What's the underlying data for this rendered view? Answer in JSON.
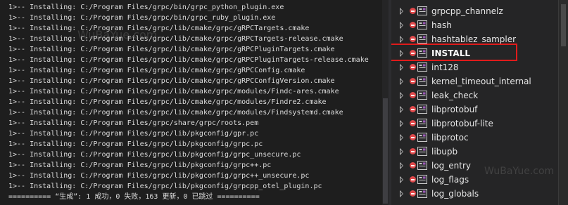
{
  "output": {
    "lines": [
      "1>-- Installing: C:/Program Files/grpc/bin/grpc_python_plugin.exe",
      "1>-- Installing: C:/Program Files/grpc/bin/grpc_ruby_plugin.exe",
      "1>-- Installing: C:/Program Files/grpc/lib/cmake/grpc/gRPCTargets.cmake",
      "1>-- Installing: C:/Program Files/grpc/lib/cmake/grpc/gRPCTargets-release.cmake",
      "1>-- Installing: C:/Program Files/grpc/lib/cmake/grpc/gRPCPluginTargets.cmake",
      "1>-- Installing: C:/Program Files/grpc/lib/cmake/grpc/gRPCPluginTargets-release.cmake",
      "1>-- Installing: C:/Program Files/grpc/lib/cmake/grpc/gRPCConfig.cmake",
      "1>-- Installing: C:/Program Files/grpc/lib/cmake/grpc/gRPCConfigVersion.cmake",
      "1>-- Installing: C:/Program Files/grpc/lib/cmake/grpc/modules/Findc-ares.cmake",
      "1>-- Installing: C:/Program Files/grpc/lib/cmake/grpc/modules/Findre2.cmake",
      "1>-- Installing: C:/Program Files/grpc/lib/cmake/grpc/modules/Findsystemd.cmake",
      "1>-- Installing: C:/Program Files/grpc/share/grpc/roots.pem",
      "1>-- Installing: C:/Program Files/grpc/lib/pkgconfig/gpr.pc",
      "1>-- Installing: C:/Program Files/grpc/lib/pkgconfig/grpc.pc",
      "1>-- Installing: C:/Program Files/grpc/lib/pkgconfig/grpc_unsecure.pc",
      "1>-- Installing: C:/Program Files/grpc/lib/pkgconfig/grpc++.pc",
      "1>-- Installing: C:/Program Files/grpc/lib/pkgconfig/grpc++_unsecure.pc",
      "1>-- Installing: C:/Program Files/grpc/lib/pkgconfig/grpcpp_otel_plugin.pc",
      "========== “生成”: 1 成功，0 失败，163 更新，0 已跳过 =========="
    ]
  },
  "explorer": {
    "items": [
      {
        "label": "grpcpp_channelz",
        "selected": false
      },
      {
        "label": "hash",
        "selected": false
      },
      {
        "label": "hashtablez_sampler",
        "selected": false
      },
      {
        "label": "INSTALL",
        "selected": true
      },
      {
        "label": "int128",
        "selected": false
      },
      {
        "label": "kernel_timeout_internal",
        "selected": false
      },
      {
        "label": "leak_check",
        "selected": false
      },
      {
        "label": "libprotobuf",
        "selected": false
      },
      {
        "label": "libprotobuf-lite",
        "selected": false
      },
      {
        "label": "libprotoc",
        "selected": false
      },
      {
        "label": "libupb",
        "selected": false
      },
      {
        "label": "log_entry",
        "selected": false
      },
      {
        "label": "log_flags",
        "selected": false
      },
      {
        "label": "log_globals",
        "selected": false
      }
    ],
    "icons": {
      "expander": "chevron-right-icon",
      "status": "error-status-icon",
      "project": "cpp-project-icon"
    }
  },
  "watermark": {
    "text_top": "WuBaYue.com",
    "text_bottom": "WuBaYue.com"
  },
  "colors": {
    "background": "#1e1e1e",
    "explorer_background": "#252526",
    "text": "#dcdcdc",
    "highlight": "#e01b1b",
    "error": "#e0484a"
  }
}
